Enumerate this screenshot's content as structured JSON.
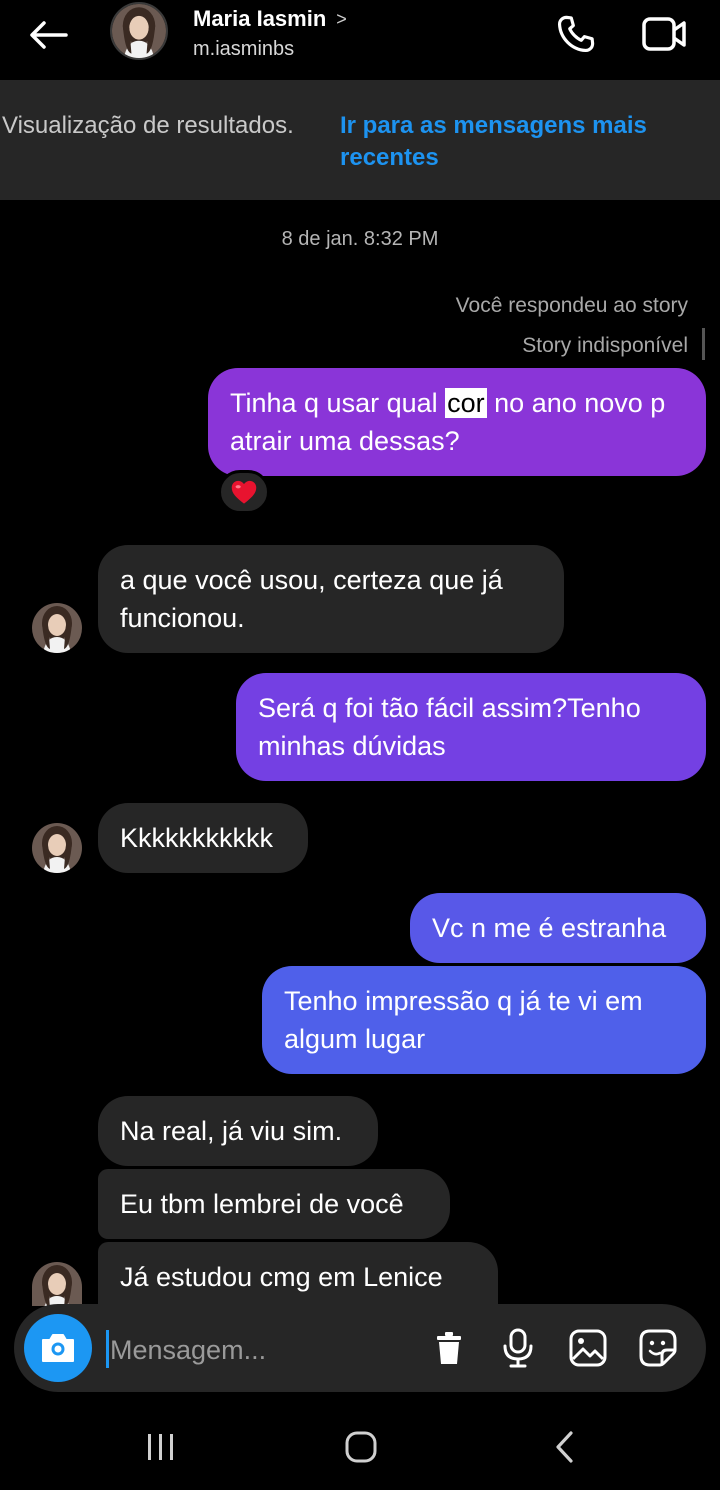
{
  "header": {
    "contact_name": "Maria Iasmin",
    "chevron": ">",
    "username": "m.iasminbs"
  },
  "banner": {
    "text": "Visualização de resultados.",
    "link": "Ir para as mensagens mais recentes"
  },
  "conversation": {
    "timestamp": "8 de jan. 8:32 PM",
    "story_note": "Você respondeu ao story",
    "story_unavailable": "Story indisponível",
    "messages": [
      {
        "from": "me",
        "before": "Tinha q usar qual ",
        "highlight": "cor",
        "after": " no ano novo p atrair uma dessas?"
      },
      {
        "from": "them",
        "text": "a que você usou, certeza que já funcionou."
      },
      {
        "from": "me",
        "text": "Será q foi tão fácil assim?Tenho minhas dúvidas"
      },
      {
        "from": "them",
        "text": "Kkkkkkkkkkk"
      },
      {
        "from": "me",
        "text": "Vc n me é estranha"
      },
      {
        "from": "me",
        "text": "Tenho impressão q já te vi em algum lugar"
      },
      {
        "from": "them",
        "text": "Na real, já viu sim."
      },
      {
        "from": "them",
        "text": "Eu tbm lembrei de você"
      },
      {
        "from": "them",
        "text": "Já estudou cmg em Lenice"
      }
    ],
    "reaction": "❤️"
  },
  "composer": {
    "placeholder": "Mensagem..."
  },
  "colors": {
    "background": "#000000",
    "incoming_bubble": "#262626",
    "outgoing_purple": "#8a35d8",
    "outgoing_indigo": "#6a48e6",
    "outgoing_blue": "#4f60ea",
    "link_blue": "#1d93f0",
    "camera_button": "#1c97f3"
  },
  "icons": [
    "back-arrow-icon",
    "phone-icon",
    "video-camera-icon",
    "camera-icon",
    "trash-icon",
    "microphone-icon",
    "gallery-icon",
    "sticker-icon",
    "recents-icon",
    "home-icon",
    "nav-back-icon"
  ]
}
